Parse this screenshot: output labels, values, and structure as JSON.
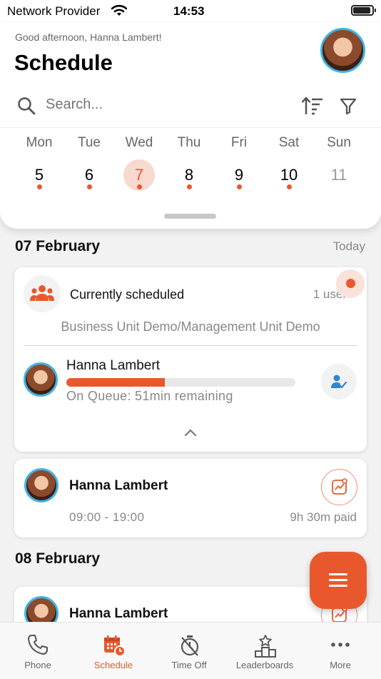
{
  "status_bar": {
    "carrier": "Network Provider",
    "time": "14:53"
  },
  "header": {
    "greeting": "Good afternoon, Hanna Lambert!",
    "title": "Schedule"
  },
  "search": {
    "placeholder": "Search..."
  },
  "week": [
    {
      "day": "Mon",
      "date": "5",
      "has_event": true,
      "state": "normal"
    },
    {
      "day": "Tue",
      "date": "6",
      "has_event": true,
      "state": "normal"
    },
    {
      "day": "Wed",
      "date": "7",
      "has_event": true,
      "state": "today"
    },
    {
      "day": "Thu",
      "date": "8",
      "has_event": true,
      "state": "normal"
    },
    {
      "day": "Fri",
      "date": "9",
      "has_event": true,
      "state": "normal"
    },
    {
      "day": "Sat",
      "date": "10",
      "has_event": true,
      "state": "normal"
    },
    {
      "day": "Sun",
      "date": "11",
      "has_event": false,
      "state": "muted"
    }
  ],
  "sections": [
    {
      "date": "07 February",
      "side_label": "Today",
      "scheduled_card": {
        "title": "Currently scheduled",
        "count": "1 user",
        "unit": "Business Unit Demo/Management Unit Demo",
        "agent": {
          "name": "Hanna Lambert",
          "status": "On Queue: 51min remaining",
          "progress": 0.43
        }
      },
      "shift_card": {
        "name": "Hanna Lambert",
        "time": "09:00 - 19:00",
        "paid": "9h 30m paid"
      }
    },
    {
      "date": "08 February",
      "side_label": "",
      "shift_card": {
        "name": "Hanna Lambert"
      }
    }
  ],
  "tabs": [
    {
      "label": "Phone",
      "icon": "phone-icon",
      "active": false
    },
    {
      "label": "Schedule",
      "icon": "calendar-clock-icon",
      "active": true
    },
    {
      "label": "Time Off",
      "icon": "timer-off-icon",
      "active": false
    },
    {
      "label": "Leaderboards",
      "icon": "podium-icon",
      "active": false
    },
    {
      "label": "More",
      "icon": "more-dots-icon",
      "active": false
    }
  ],
  "colors": {
    "accent": "#e9582c",
    "avatar_ring": "#3fb3e6",
    "today_bg": "#f7d9cf",
    "assign_blue": "#2f86d0"
  }
}
